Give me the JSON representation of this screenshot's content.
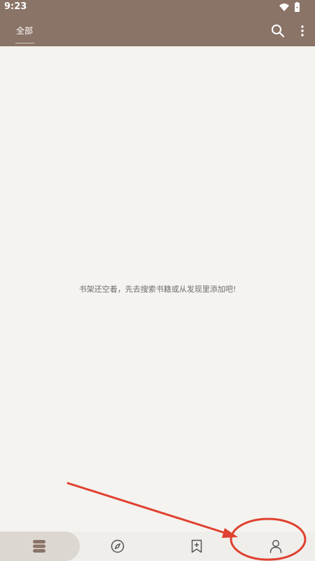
{
  "status_bar": {
    "time": "9:23",
    "icons": [
      "wifi-icon",
      "battery-icon"
    ]
  },
  "app_bar": {
    "tab_label": "全部",
    "actions": [
      "search-icon",
      "more-vertical-icon"
    ]
  },
  "main": {
    "empty_message": "书架还空着，先去搜索书籍或从发现里添加吧!"
  },
  "bottom_nav": {
    "items": [
      {
        "icon": "bookshelf-icon",
        "selected": true
      },
      {
        "icon": "compass-icon",
        "selected": false
      },
      {
        "icon": "bookmark-add-icon",
        "selected": false
      },
      {
        "icon": "person-icon",
        "selected": false
      }
    ]
  },
  "colors": {
    "app_bar": "#8a7467",
    "background": "#f4f3ef",
    "bottom_nav": "#efeeeb",
    "selected_pill": "#dcd7d1",
    "annotation": "#e0402f"
  }
}
